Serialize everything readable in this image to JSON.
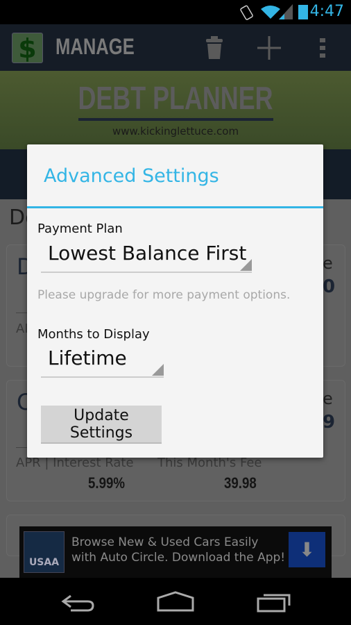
{
  "status": {
    "time": "4:47"
  },
  "actionbar": {
    "title": "MANAGE",
    "logo": "$"
  },
  "banner": {
    "title": "DEBT PLANNER",
    "site": "www.kickinglettuce.com"
  },
  "background": {
    "heading_fragment": "De",
    "cards": [
      {
        "name_fragment": "D",
        "right_fragment": "e",
        "value_fragment": "0",
        "apr_fragment": "AP"
      },
      {
        "name_fragment": "C",
        "right_fragment": "e",
        "value_fragment": "9",
        "apr_label": "APR | Interest Rate",
        "apr_value": "5.99%",
        "fee_label": "This Month's Fee",
        "fee_value": "39.98"
      }
    ]
  },
  "ad": {
    "brand": "USAA",
    "text": "Browse New & Used Cars Easily with Auto Circle. Download the App!"
  },
  "dialog": {
    "title": "Advanced Settings",
    "payment_label": "Payment Plan",
    "payment_value": "Lowest Balance First",
    "hint": "Please upgrade for more payment options.",
    "months_label": "Months to Display",
    "months_value": "Lifetime",
    "button": "Update Settings"
  },
  "colors": {
    "accent": "#33b5e5"
  }
}
